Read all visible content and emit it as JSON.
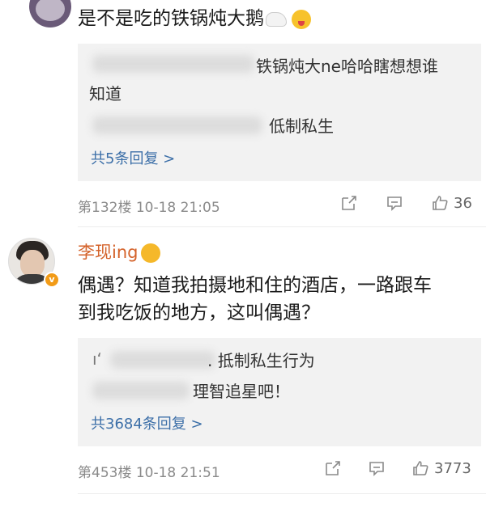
{
  "thread": [
    {
      "comment_text": "是不是吃的铁锅炖大鹅",
      "replies": [
        {
          "visible_text_line1": "铁锅炖大ne哈哈瞎想想谁",
          "visible_text_line2": "知道"
        },
        {
          "visible_text": "低制私生"
        }
      ],
      "more_replies": "共5条回复 >",
      "floor_meta": "第132楼 10-18 21:05",
      "like_count": "36"
    },
    {
      "username": "李现ing",
      "comment_line1": "偶遇？知道我拍摄地和住的酒店，一路跟车",
      "comment_line2": "到我吃饭的地方，这叫偶遇？",
      "replies": [
        {
          "prefix": "ıʻ",
          "visible_text": ". 抵制私生行为"
        },
        {
          "visible_text": "理智追星吧！"
        }
      ],
      "more_replies": "共3684条回复 >",
      "floor_meta": "第453楼 10-18 21:51",
      "like_count": "3773"
    }
  ],
  "colors": {
    "username": "#d4622a",
    "link": "#3c6fa8",
    "meta": "#8a8a8a",
    "reply_bg": "#f2f2f2",
    "verify_badge": "#f29b17"
  },
  "icons": [
    "goose-emoji",
    "tongue-out-emoji",
    "repost-icon",
    "comment-icon",
    "like-icon",
    "verified-badge-icon",
    "surprised-emoji"
  ]
}
